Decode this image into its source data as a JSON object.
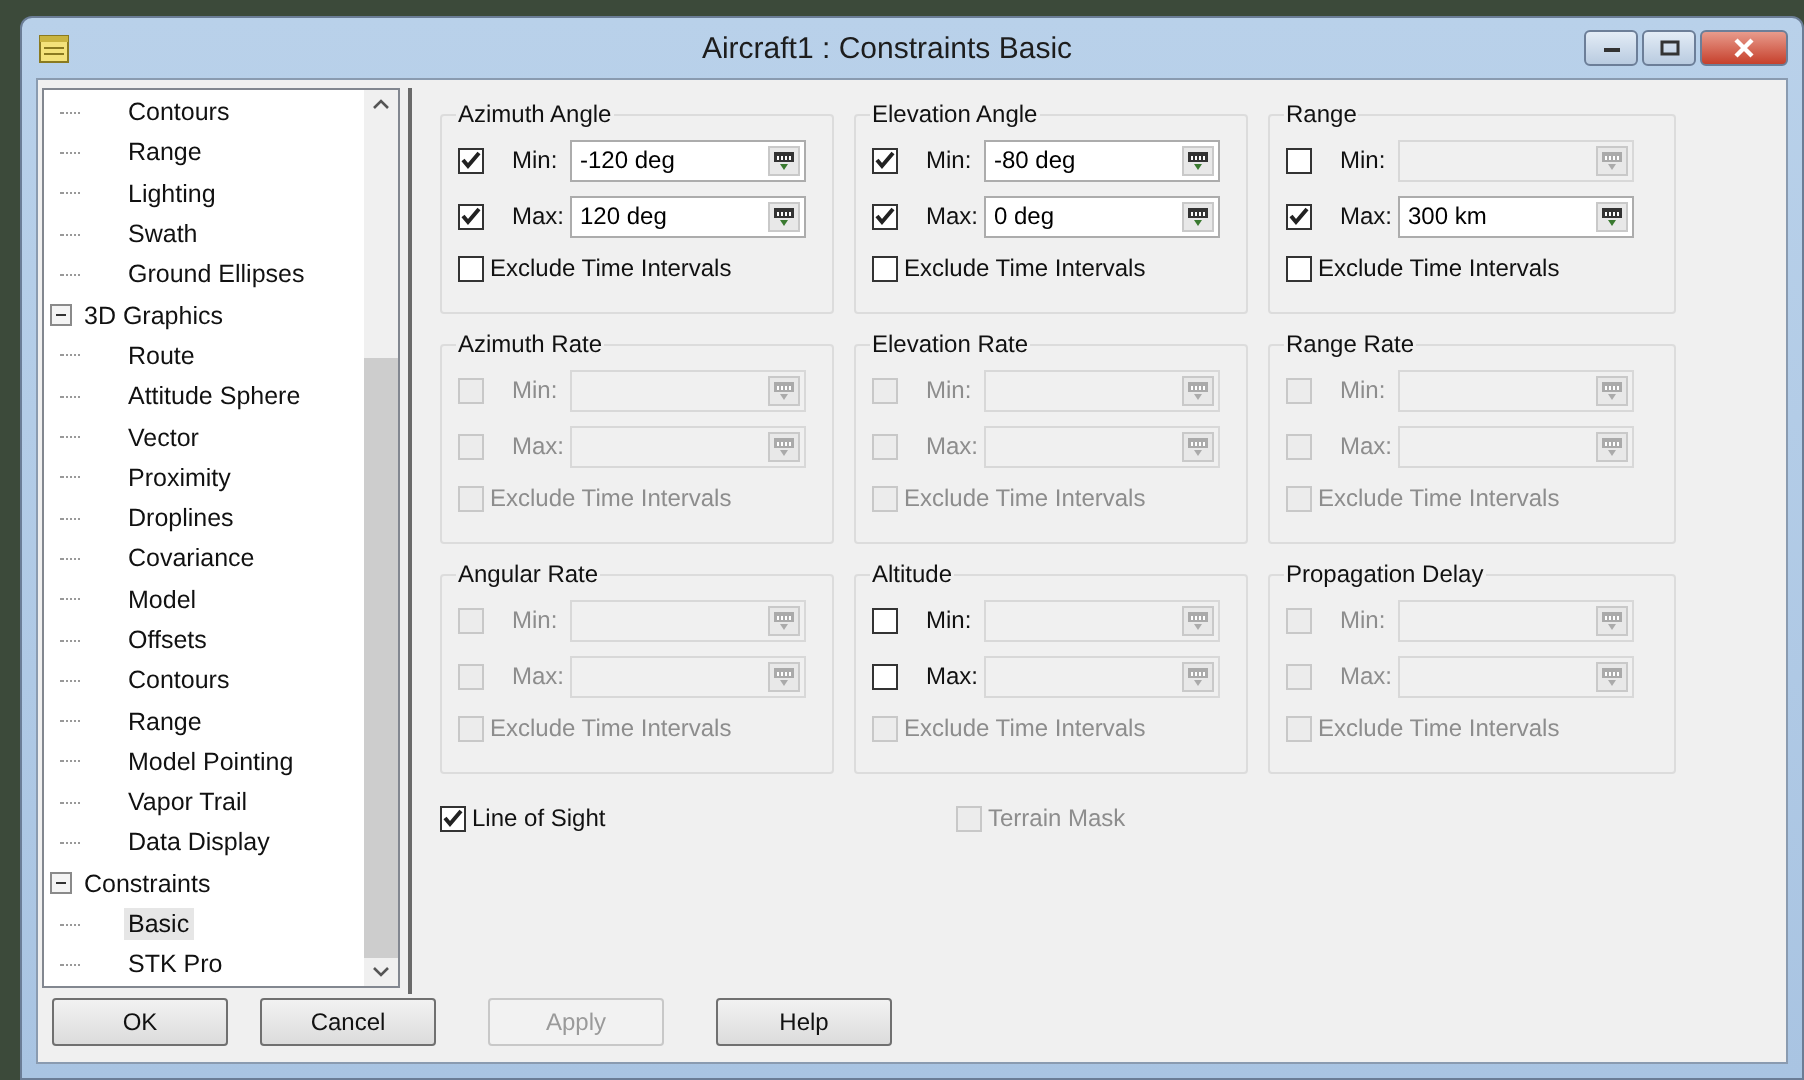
{
  "window": {
    "title": "Aircraft1 : Constraints Basic"
  },
  "tree": [
    {
      "children": [
        {
          "label": "Contours",
          "selected": false
        },
        {
          "label": "Range",
          "selected": false
        },
        {
          "label": "Lighting",
          "selected": false
        },
        {
          "label": "Swath",
          "selected": false
        },
        {
          "label": "Ground Ellipses",
          "selected": false
        }
      ]
    },
    {
      "label": "3D Graphics",
      "expanded": true,
      "selected": false,
      "children": [
        {
          "label": "Route",
          "selected": false
        },
        {
          "label": "Attitude Sphere",
          "selected": false
        },
        {
          "label": "Vector",
          "selected": false
        },
        {
          "label": "Proximity",
          "selected": false
        },
        {
          "label": "Droplines",
          "selected": false
        },
        {
          "label": "Covariance",
          "selected": false
        },
        {
          "label": "Model",
          "selected": false
        },
        {
          "label": "Offsets",
          "selected": false
        },
        {
          "label": "Contours",
          "selected": false
        },
        {
          "label": "Range",
          "selected": false
        },
        {
          "label": "Model Pointing",
          "selected": false
        },
        {
          "label": "Vapor Trail",
          "selected": false
        },
        {
          "label": "Data Display",
          "selected": false
        }
      ]
    },
    {
      "label": "Constraints",
      "expanded": true,
      "selected": false,
      "children": [
        {
          "label": "Basic",
          "selected": true
        },
        {
          "label": "STK Pro",
          "selected": false
        }
      ]
    }
  ],
  "groups": [
    {
      "title": "Azimuth Angle",
      "rows": [
        {
          "label": "Min:",
          "enabled": true,
          "checked": true,
          "value": "-120 deg"
        },
        {
          "label": "Max:",
          "enabled": true,
          "checked": true,
          "value": "120 deg"
        }
      ],
      "exclude": {
        "label": "Exclude Time Intervals",
        "enabled": true,
        "checked": false
      }
    },
    {
      "title": "Elevation Angle",
      "rows": [
        {
          "label": "Min:",
          "enabled": true,
          "checked": true,
          "value": "-80 deg"
        },
        {
          "label": "Max:",
          "enabled": true,
          "checked": true,
          "value": "0 deg"
        }
      ],
      "exclude": {
        "label": "Exclude Time Intervals",
        "enabled": true,
        "checked": false
      }
    },
    {
      "title": "Range",
      "rows": [
        {
          "label": "Min:",
          "enabled": true,
          "checked": false
        },
        {
          "label": "Max:",
          "enabled": true,
          "checked": true,
          "value": "300 km"
        }
      ],
      "exclude": {
        "label": "Exclude Time Intervals",
        "enabled": true,
        "checked": false
      }
    },
    {
      "title": "Azimuth Rate",
      "rows": [
        {
          "label": "Min:",
          "enabled": false,
          "checked": false
        },
        {
          "label": "Max:",
          "enabled": false,
          "checked": false
        }
      ],
      "exclude": {
        "label": "Exclude Time Intervals",
        "enabled": false,
        "checked": false
      }
    },
    {
      "title": "Elevation Rate",
      "rows": [
        {
          "label": "Min:",
          "enabled": false,
          "checked": false
        },
        {
          "label": "Max:",
          "enabled": false,
          "checked": false
        }
      ],
      "exclude": {
        "label": "Exclude Time Intervals",
        "enabled": false,
        "checked": false
      }
    },
    {
      "title": "Range Rate",
      "rows": [
        {
          "label": "Min:",
          "enabled": false,
          "checked": false
        },
        {
          "label": "Max:",
          "enabled": false,
          "checked": false
        }
      ],
      "exclude": {
        "label": "Exclude Time Intervals",
        "enabled": false,
        "checked": false
      }
    },
    {
      "title": "Angular Rate",
      "rows": [
        {
          "label": "Min:",
          "enabled": false,
          "checked": false
        },
        {
          "label": "Max:",
          "enabled": false,
          "checked": false
        }
      ],
      "exclude": {
        "label": "Exclude Time Intervals",
        "enabled": false,
        "checked": false
      }
    },
    {
      "title": "Altitude",
      "rows": [
        {
          "label": "Min:",
          "enabled": true,
          "checked": false
        },
        {
          "label": "Max:",
          "enabled": true,
          "checked": false
        }
      ],
      "exclude": {
        "label": "Exclude Time Intervals",
        "enabled": false,
        "checked": false
      }
    },
    {
      "title": "Propagation Delay",
      "rows": [
        {
          "label": "Min:",
          "enabled": false,
          "checked": false
        },
        {
          "label": "Max:",
          "enabled": false,
          "checked": false
        }
      ],
      "exclude": {
        "label": "Exclude Time Intervals",
        "enabled": false,
        "checked": false
      }
    }
  ],
  "options": [
    {
      "label": "Line of Sight",
      "enabled": true,
      "checked": true
    },
    {
      "label": "Terrain Mask",
      "enabled": false,
      "checked": false
    }
  ],
  "buttons": [
    {
      "label": "OK",
      "disabled": false
    },
    {
      "label": "Cancel",
      "disabled": false
    },
    {
      "label": "Apply",
      "disabled": true
    },
    {
      "label": "Help",
      "disabled": false
    }
  ]
}
